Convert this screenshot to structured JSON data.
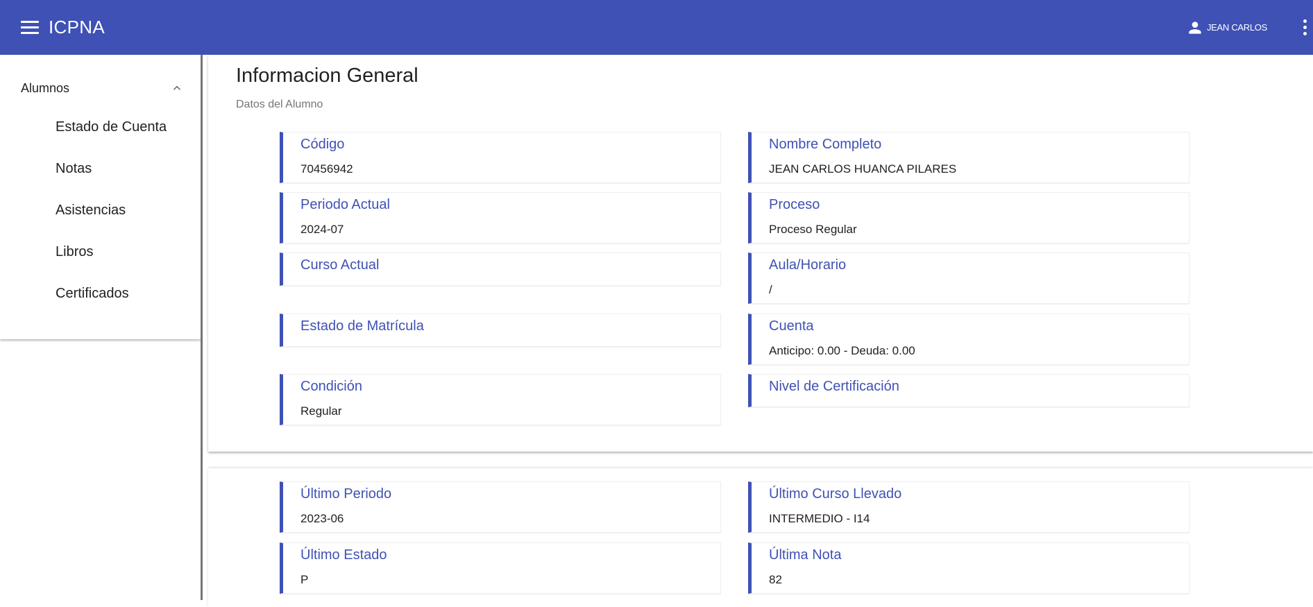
{
  "header": {
    "brand": "ICPNA",
    "user_name": "JEAN CARLOS"
  },
  "sidebar": {
    "group_label": "Alumnos",
    "items": [
      {
        "label": "Estado de Cuenta"
      },
      {
        "label": "Notas"
      },
      {
        "label": "Asistencias"
      },
      {
        "label": "Libros"
      },
      {
        "label": "Certificados"
      }
    ]
  },
  "general": {
    "title": "Informacion General",
    "subtitle": "Datos del Alumno",
    "fields": {
      "codigo": {
        "label": "Código",
        "value": "70456942"
      },
      "nombre": {
        "label": "Nombre Completo",
        "value": "JEAN CARLOS HUANCA PILARES"
      },
      "periodo": {
        "label": "Periodo Actual",
        "value": "2024-07"
      },
      "proceso": {
        "label": "Proceso",
        "value": "Proceso Regular"
      },
      "curso": {
        "label": "Curso Actual",
        "value": ""
      },
      "aula": {
        "label": "Aula/Horario",
        "value": "/"
      },
      "estado_matricula": {
        "label": "Estado de Matrícula",
        "value": ""
      },
      "cuenta": {
        "label": "Cuenta",
        "value": "Anticipo: 0.00 - Deuda: 0.00"
      },
      "condicion": {
        "label": "Condición",
        "value": "Regular"
      },
      "nivel": {
        "label": "Nivel de Certificación",
        "value": ""
      }
    }
  },
  "history": {
    "fields": {
      "ultimo_periodo": {
        "label": "Último Periodo",
        "value": "2023-06"
      },
      "ultimo_curso": {
        "label": "Último Curso Llevado",
        "value": "INTERMEDIO - I14"
      },
      "ultimo_estado": {
        "label": "Último Estado",
        "value": "P"
      },
      "ultima_nota": {
        "label": "Última Nota",
        "value": "82"
      }
    }
  },
  "colors": {
    "primary": "#3f51b5",
    "text": "#212121",
    "muted": "#757575"
  }
}
